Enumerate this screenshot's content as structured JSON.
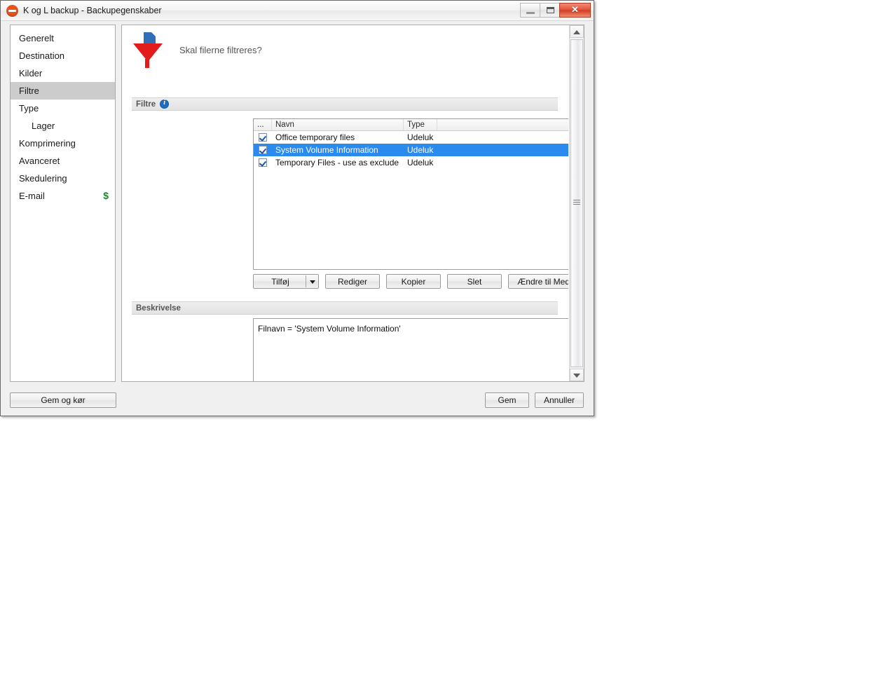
{
  "window": {
    "title": "K og L backup - Backupegenskaber",
    "app_icon": "eject-circle-icon",
    "accent_close": "#d33c22",
    "buttons": {
      "minimize": "minimize-icon",
      "maximize": "maximize-icon",
      "close": "✕"
    }
  },
  "sidebar": {
    "items": [
      {
        "label": "Generelt",
        "selected": false,
        "indent": false,
        "badge": ""
      },
      {
        "label": "Destination",
        "selected": false,
        "indent": false,
        "badge": ""
      },
      {
        "label": "Kilder",
        "selected": false,
        "indent": false,
        "badge": ""
      },
      {
        "label": "Filtre",
        "selected": true,
        "indent": false,
        "badge": ""
      },
      {
        "label": "Type",
        "selected": false,
        "indent": false,
        "badge": ""
      },
      {
        "label": "Lager",
        "selected": false,
        "indent": true,
        "badge": ""
      },
      {
        "label": "Komprimering",
        "selected": false,
        "indent": false,
        "badge": ""
      },
      {
        "label": "Avanceret",
        "selected": false,
        "indent": false,
        "badge": ""
      },
      {
        "label": "Skedulering",
        "selected": false,
        "indent": false,
        "badge": ""
      },
      {
        "label": "E-mail",
        "selected": false,
        "indent": false,
        "badge": "$"
      }
    ]
  },
  "main": {
    "header": {
      "icon": "funnel-icon",
      "question": "Skal filerne filtreres?"
    },
    "filters_group": {
      "label": "Filtre",
      "info_icon": "info-icon"
    },
    "list": {
      "columns": [
        "...",
        "Navn",
        "Type"
      ],
      "rows": [
        {
          "checked": true,
          "name": "Office temporary files",
          "type": "Udeluk",
          "selected": false
        },
        {
          "checked": true,
          "name": "System Volume Information",
          "type": "Udeluk",
          "selected": true
        },
        {
          "checked": true,
          "name": "Temporary Files - use as exclude",
          "type": "Udeluk",
          "selected": false
        }
      ]
    },
    "actions": {
      "add": "Tilføj",
      "edit": "Rediger",
      "copy": "Kopier",
      "delete": "Slet",
      "toggle": "Ændre til Medtag"
    },
    "description_group": {
      "label": "Beskrivelse"
    },
    "description": {
      "text": "Filnavn = 'System Volume Information'"
    }
  },
  "footer": {
    "save_and_run": "Gem og kør",
    "save": "Gem",
    "cancel": "Annuller"
  }
}
